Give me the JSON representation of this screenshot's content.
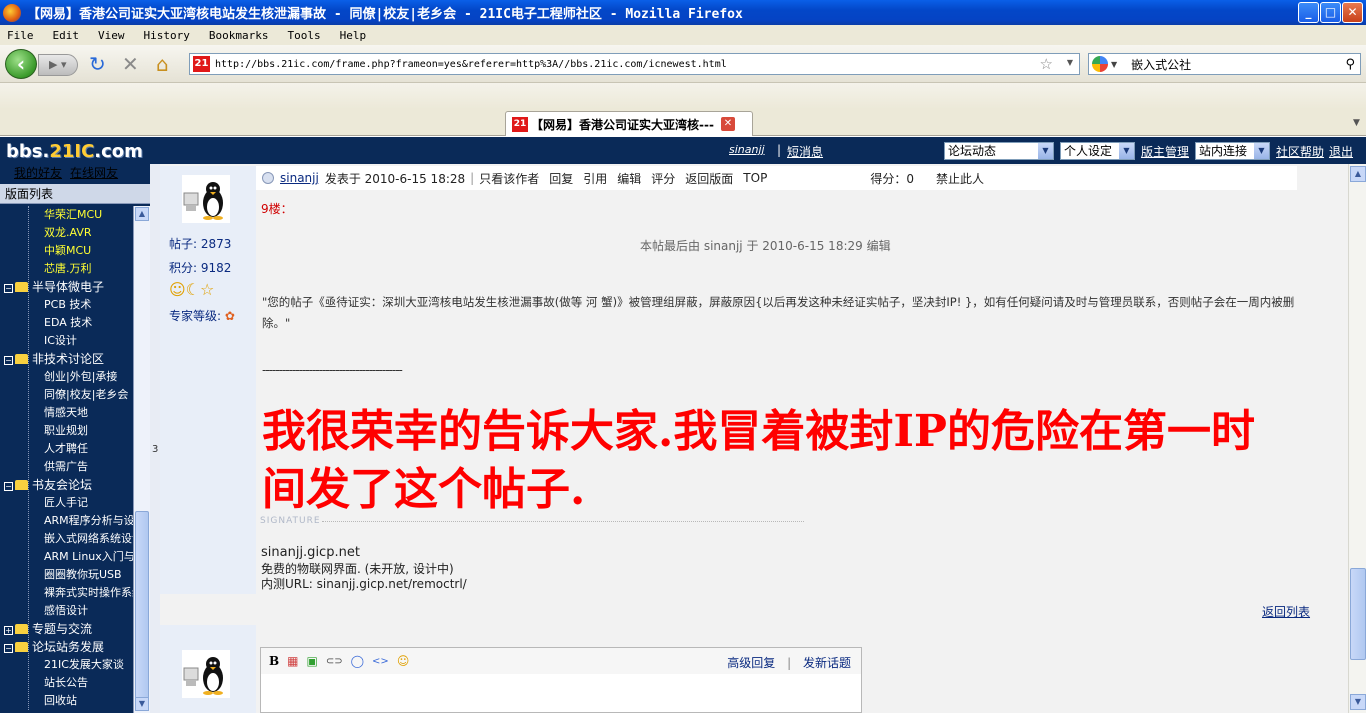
{
  "window": {
    "title": "【网易】香港公司证实大亚湾核电站发生核泄漏事故 - 同僚|校友|老乡会 - 21IC电子工程师社区 - Mozilla Firefox",
    "min": "_",
    "max": "□",
    "close": "✕"
  },
  "menu": [
    "File",
    "Edit",
    "View",
    "History",
    "Bookmarks",
    "Tools",
    "Help"
  ],
  "nav": {
    "url": "http://bbs.21ic.com/frame.php?frameon=yes&referer=http%3A//bbs.21ic.com/icnewest.html",
    "site_badge": "21",
    "search_value": "嵌入式公社",
    "icons": [
      "back-icon",
      "forward-icon",
      "reload-icon",
      "stop-icon",
      "home-icon",
      "star-icon",
      "search-icon"
    ]
  },
  "tab": {
    "label": "【网易】香港公司证实大亚湾核---",
    "badge": "21"
  },
  "sitebar": {
    "logo_a": "bbs.",
    "logo_b": "21IC",
    "logo_c": ".com",
    "user": "sinanjj",
    "messages": "短消息",
    "select_forum": "论坛动态",
    "select_settings": "个人设定",
    "moderator": "版主管理",
    "select_links": "站内连接",
    "help": "社区帮助",
    "logout": "退出"
  },
  "left": {
    "friends": "我的好友",
    "online": "在线网友",
    "list_title": "版面列表",
    "tree": [
      {
        "label": "华荣汇MCU",
        "kind": "leaf",
        "color": "y"
      },
      {
        "label": "双龙.AVR",
        "kind": "leaf",
        "color": "y"
      },
      {
        "label": "中颖MCU",
        "kind": "leaf",
        "color": "y"
      },
      {
        "label": "芯唐.万利",
        "kind": "leaf",
        "color": "y"
      },
      {
        "label": "半导体微电子",
        "kind": "group",
        "box": "⊟"
      },
      {
        "label": "PCB 技术",
        "kind": "leaf",
        "color": "w"
      },
      {
        "label": "EDA 技术",
        "kind": "leaf",
        "color": "w"
      },
      {
        "label": "IC设计",
        "kind": "leaf",
        "color": "w"
      },
      {
        "label": "非技术讨论区",
        "kind": "group",
        "box": "⊟"
      },
      {
        "label": "创业|外包|承接",
        "kind": "leaf",
        "color": "w"
      },
      {
        "label": "同僚|校友|老乡会",
        "kind": "leaf",
        "color": "w"
      },
      {
        "label": "情感天地",
        "kind": "leaf",
        "color": "w"
      },
      {
        "label": "职业规划",
        "kind": "leaf",
        "color": "w"
      },
      {
        "label": "人才聘任",
        "kind": "leaf",
        "color": "w"
      },
      {
        "label": "供需广告",
        "kind": "leaf",
        "color": "w"
      },
      {
        "label": "书友会论坛",
        "kind": "group",
        "box": "⊟"
      },
      {
        "label": "匠人手记",
        "kind": "leaf",
        "color": "w"
      },
      {
        "label": "ARM程序分析与设计",
        "kind": "leaf",
        "color": "w"
      },
      {
        "label": "嵌入式网络系统设计",
        "kind": "leaf",
        "color": "w"
      },
      {
        "label": "ARM Linux入门与实践",
        "kind": "leaf",
        "color": "w"
      },
      {
        "label": "圈圈教你玩USB",
        "kind": "leaf",
        "color": "w"
      },
      {
        "label": "裸奔式实时操作系统",
        "kind": "leaf",
        "color": "w"
      },
      {
        "label": "感悟设计",
        "kind": "leaf",
        "color": "w"
      },
      {
        "label": "专题与交流",
        "kind": "group",
        "box": "⊞"
      },
      {
        "label": "论坛站务发展",
        "kind": "group",
        "box": "⊟"
      },
      {
        "label": "21IC发展大家谈",
        "kind": "leaf",
        "color": "w"
      },
      {
        "label": "站长公告",
        "kind": "leaf",
        "color": "w"
      },
      {
        "label": "回收站",
        "kind": "leaf",
        "color": "w"
      }
    ],
    "divider_num": "3"
  },
  "post": {
    "author": "sinanjj",
    "posted": "发表于 2010-6-15 18:28",
    "actions": [
      "只看该作者",
      "回复",
      "引用",
      "编辑",
      "评分",
      "返回版面",
      "TOP"
    ],
    "score": "得分：0",
    "ban": "禁止此人",
    "floor": "9楼：",
    "edit_note": "本帖最后由 sinanjj 于 2010-6-15 18:29 编辑",
    "quote": "\"您的帖子《亟待证实：深圳大亚湾核电站发生核泄漏事故(做等 河 蟹)》被管理组屏蔽，屏蔽原因{以后再发这种未经证实帖子，坚决封IP! }，如有任何疑问请及时与管理员联系，否则帖子会在一周内被删除。\"",
    "dash": "------------------------------------------",
    "big_text": "我很荣幸的告诉大家.我冒着被封IP的危险在第一时间发了这个帖子.",
    "signature_label": "SIGNATURE",
    "sig1": "sinanjj.gicp.net",
    "sig2": "免费的物联网界面. (未开放, 设计中)",
    "sig3": "内测URL: sinanjj.gicp.net/remoctrl/",
    "back_list": "返回列表"
  },
  "user": {
    "posts_label": "帖子: 2873",
    "points_label": "积分: 9182",
    "level_label": "专家等级:",
    "badges": "☺☾☆"
  },
  "reply": {
    "tools": [
      "B",
      "▦",
      "▣",
      "⊂⊃",
      "◯",
      "<>",
      "☺"
    ],
    "advanced": "高级回复",
    "sep": "|",
    "new_topic": "发新话题"
  }
}
